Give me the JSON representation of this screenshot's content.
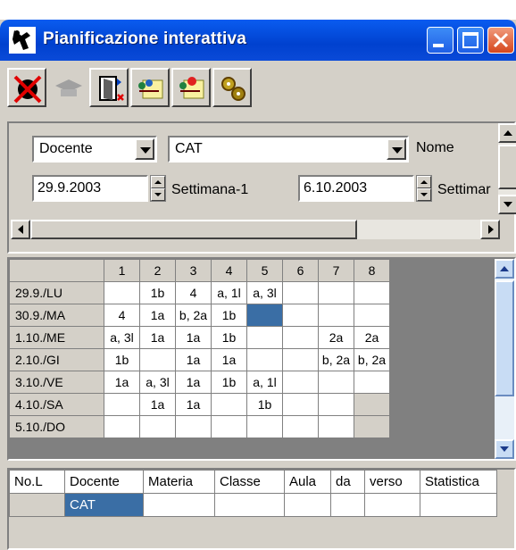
{
  "window": {
    "title": "Pianificazione interattiva"
  },
  "toolbar": {
    "buttons": [
      "delete-icon",
      "graduation-cap-icon",
      "exit-door-icon",
      "map-pin-icon",
      "map-pin-red-icon",
      "gears-icon"
    ]
  },
  "filters": {
    "type": "Docente",
    "name_value": "CAT",
    "name_label": "Nome",
    "date1": "29.9.2003",
    "date1_label": "Settimana-1",
    "date2": "6.10.2003",
    "date2_label": "Settimar"
  },
  "grid": {
    "columns": [
      "1",
      "2",
      "3",
      "4",
      "5",
      "6",
      "7",
      "8"
    ],
    "rows": [
      {
        "label": "29.9./LU",
        "cells": [
          "",
          "1b",
          "4",
          "a, 1l",
          "a, 3l",
          "",
          "",
          ""
        ]
      },
      {
        "label": "30.9./MA",
        "cells": [
          "4",
          "1a",
          "b, 2a",
          "1b",
          "",
          "",
          "",
          ""
        ]
      },
      {
        "label": "1.10./ME",
        "cells": [
          "a, 3l",
          "1a",
          "1a",
          "1b",
          "",
          "",
          "2a",
          "2a"
        ]
      },
      {
        "label": "2.10./GI",
        "cells": [
          "1b",
          "",
          "1a",
          "1a",
          "",
          "",
          "b, 2a",
          "b, 2a"
        ]
      },
      {
        "label": "3.10./VE",
        "cells": [
          "1a",
          "a, 3l",
          "1a",
          "1b",
          "a, 1l",
          "",
          "",
          ""
        ]
      },
      {
        "label": "4.10./SA",
        "cells": [
          "",
          "1a",
          "1a",
          "",
          "1b",
          "",
          "",
          ""
        ]
      },
      {
        "label": "5.10./DO",
        "cells": [
          "",
          "",
          "",
          "",
          "",
          "",
          "",
          ""
        ]
      }
    ]
  },
  "lessons": {
    "headers": [
      "No.L",
      "Docente",
      "Materia",
      "Classe",
      "Aula",
      "da",
      "verso",
      "Statistica"
    ],
    "row": [
      "",
      "CAT",
      "",
      "",
      "",
      "",
      "",
      ""
    ]
  },
  "colors": {
    "title_bar": "#0041cf",
    "selection": "#3a6ea5",
    "face": "#d4d0c8"
  }
}
